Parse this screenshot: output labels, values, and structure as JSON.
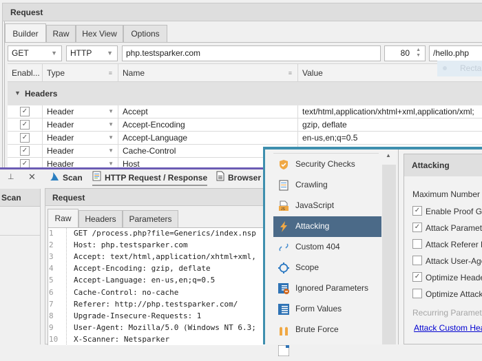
{
  "builder": {
    "title": "Request",
    "tabs": [
      "Builder",
      "Raw",
      "Hex View",
      "Options"
    ],
    "active_tab": "Builder",
    "method": "GET",
    "protocol": "HTTP",
    "host": "php.testsparker.com",
    "port": "80",
    "path": "/hello.php",
    "columns": [
      "Enabl...",
      "Type",
      "Name",
      "Value"
    ],
    "group_label": "Headers",
    "rows": [
      {
        "enabled": true,
        "type": "Header",
        "name": "Accept",
        "value": "text/html,application/xhtml+xml,application/xml;"
      },
      {
        "enabled": true,
        "type": "Header",
        "name": "Accept-Encoding",
        "value": "gzip, deflate"
      },
      {
        "enabled": true,
        "type": "Header",
        "name": "Accept-Language",
        "value": "en-us,en;q=0.5"
      },
      {
        "enabled": true,
        "type": "Header",
        "name": "Cache-Control",
        "value": ""
      },
      {
        "enabled": true,
        "type": "Header",
        "name": "Host",
        "value": ""
      }
    ],
    "ghost_label": "Rectan"
  },
  "scan_window": {
    "side_panel_title": "Scan",
    "doc_tabs": [
      {
        "label": "Scan",
        "icon": "shark-fin-icon"
      },
      {
        "label": "HTTP Request / Response",
        "icon": "document-icon"
      },
      {
        "label": "Browser",
        "icon": "page-icon"
      }
    ],
    "active_doc_tab": "HTTP Request / Response",
    "request_panel_title": "Request",
    "request_tabs": [
      "Raw",
      "Headers",
      "Parameters"
    ],
    "active_request_tab": "Raw",
    "raw_lines": [
      "GET /process.php?file=Generics/index.nsp",
      "Host: php.testsparker.com",
      "Accept: text/html,application/xhtml+xml,",
      "Accept-Encoding: gzip, deflate",
      "Accept-Language: en-us,en;q=0.5",
      "Cache-Control: no-cache",
      "Referer: http://php.testsparker.com/",
      "Upgrade-Insecure-Requests: 1",
      "User-Agent: Mozilla/5.0 (Windows NT 6.3;",
      "X-Scanner: Netsparker"
    ]
  },
  "options": {
    "nav_items": [
      {
        "label": "Security Checks",
        "icon": "shield-icon"
      },
      {
        "label": "Crawling",
        "icon": "crawl-document-icon"
      },
      {
        "label": "JavaScript",
        "icon": "javascript-file-icon"
      },
      {
        "label": "Attacking",
        "icon": "lightning-icon"
      },
      {
        "label": "Custom 404",
        "icon": "broken-link-icon"
      },
      {
        "label": "Scope",
        "icon": "target-icon"
      },
      {
        "label": "Ignored Parameters",
        "icon": "ignored-list-icon"
      },
      {
        "label": "Form Values",
        "icon": "form-list-icon"
      },
      {
        "label": "Brute Force",
        "icon": "fists-icon"
      }
    ],
    "active_item": "Attacking",
    "panel_title": "Attacking",
    "max_label": "Maximum Number",
    "checks": [
      {
        "label": "Enable Proof Ge",
        "checked": true
      },
      {
        "label": "Attack Paramete",
        "checked": true
      },
      {
        "label": "Attack Referer H",
        "checked": false
      },
      {
        "label": "Attack User-Age",
        "checked": false
      },
      {
        "label": "Optimize Heade",
        "checked": true
      },
      {
        "label": "Optimize Attack",
        "checked": false
      }
    ],
    "recurring_label": "Recurring Paramete",
    "custom_link": "Attack Custom Hea"
  },
  "colors": {
    "accent_teal": "#3e8fae",
    "selected_nav": "#4b6a88",
    "splitter_purple": "#6b5bb4",
    "link_blue": "#0000d0"
  }
}
